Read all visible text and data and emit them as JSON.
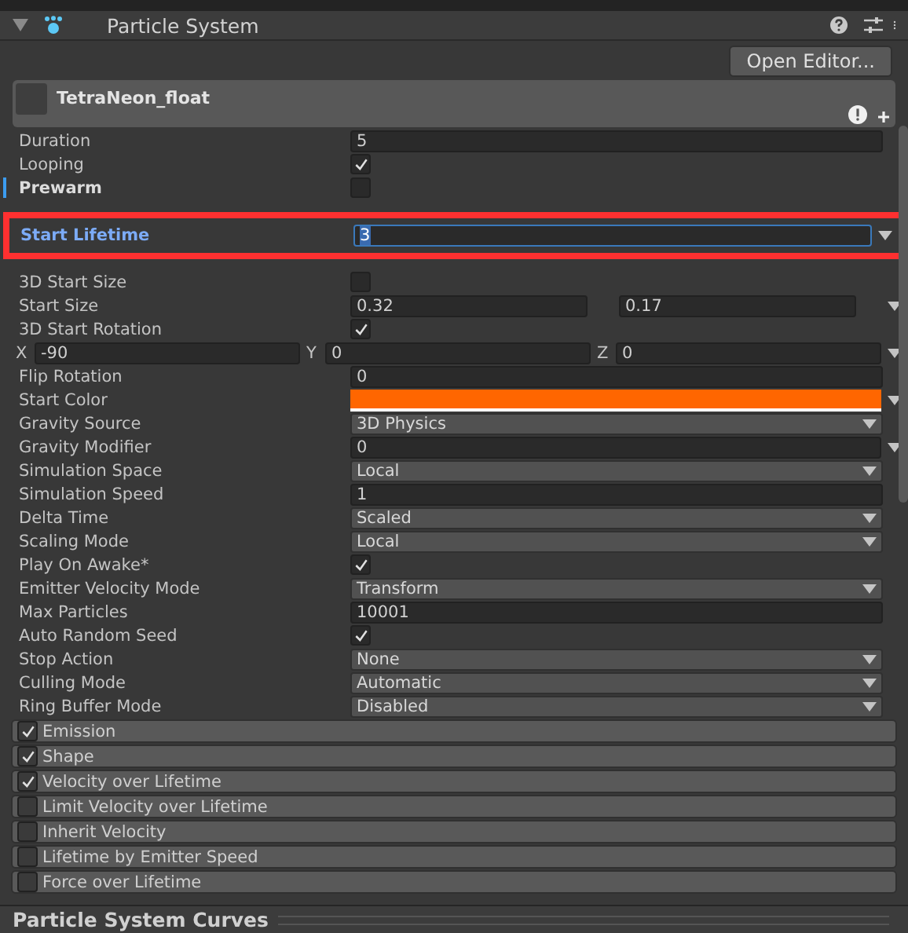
{
  "component": {
    "title": "Particle System",
    "expanded": true
  },
  "open_editor": "Open Editor...",
  "system": {
    "name": "TetraNeon_float"
  },
  "properties": [
    {
      "kind": "field",
      "label": "Duration",
      "value": "5"
    },
    {
      "kind": "checkbox",
      "label": "Looping",
      "checked": true
    },
    {
      "kind": "checkbox",
      "label": "Prewarm",
      "checked": false,
      "modified": true
    },
    {
      "kind": "curve_field",
      "label": "Start Lifetime",
      "value": "3",
      "highlighted": true
    },
    {
      "kind": "checkbox",
      "label": "3D Start Size",
      "checked": false
    },
    {
      "kind": "range",
      "label": "Start Size",
      "values": [
        "0.32",
        "0.17"
      ]
    },
    {
      "kind": "checkbox",
      "label": "3D Start Rotation",
      "checked": true
    },
    {
      "kind": "xyz",
      "values": [
        {
          "axis": "X",
          "value": "-90"
        },
        {
          "axis": "Y",
          "value": "0"
        },
        {
          "axis": "Z",
          "value": "0"
        }
      ]
    },
    {
      "kind": "field",
      "label": "Flip Rotation",
      "value": "0"
    },
    {
      "kind": "color",
      "label": "Start Color",
      "color": "#ff6600"
    },
    {
      "kind": "dropdown",
      "label": "Gravity Source",
      "value": "3D Physics"
    },
    {
      "kind": "curve_field",
      "label": "Gravity Modifier",
      "value": "0"
    },
    {
      "kind": "dropdown",
      "label": "Simulation Space",
      "value": "Local"
    },
    {
      "kind": "field",
      "label": "Simulation Speed",
      "value": "1"
    },
    {
      "kind": "dropdown",
      "label": "Delta Time",
      "value": "Scaled"
    },
    {
      "kind": "dropdown",
      "label": "Scaling Mode",
      "value": "Local"
    },
    {
      "kind": "checkbox",
      "label": "Play On Awake*",
      "checked": true
    },
    {
      "kind": "dropdown",
      "label": "Emitter Velocity Mode",
      "value": "Transform"
    },
    {
      "kind": "field",
      "label": "Max Particles",
      "value": "10001"
    },
    {
      "kind": "checkbox",
      "label": "Auto Random Seed",
      "checked": true
    },
    {
      "kind": "dropdown",
      "label": "Stop Action",
      "value": "None"
    },
    {
      "kind": "dropdown",
      "label": "Culling Mode",
      "value": "Automatic"
    },
    {
      "kind": "dropdown",
      "label": "Ring Buffer Mode",
      "value": "Disabled"
    }
  ],
  "modules": [
    {
      "label": "Emission",
      "checked": true
    },
    {
      "label": "Shape",
      "checked": true
    },
    {
      "label": "Velocity over Lifetime",
      "checked": true
    },
    {
      "label": "Limit Velocity over Lifetime",
      "checked": false
    },
    {
      "label": "Inherit Velocity",
      "checked": false
    },
    {
      "label": "Lifetime by Emitter Speed",
      "checked": false
    },
    {
      "label": "Force over Lifetime",
      "checked": false
    }
  ],
  "curves_title": "Particle System Curves"
}
